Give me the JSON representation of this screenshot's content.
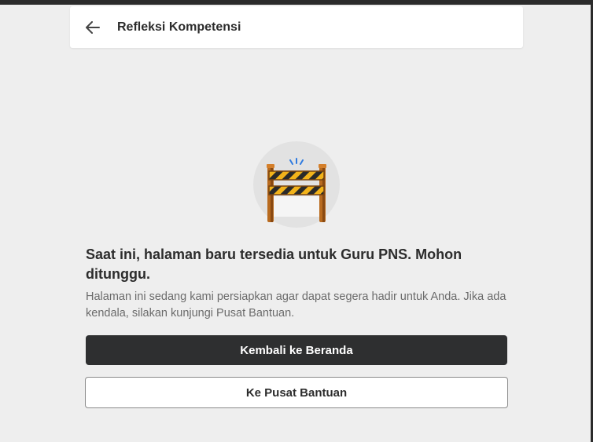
{
  "header": {
    "back_icon": "arrow-left-icon",
    "title": "Refleksi Kompetensi"
  },
  "illustration": {
    "icon": "road-barrier-icon"
  },
  "message": {
    "title": "Saat ini, halaman baru tersedia untuk Guru PNS. Mohon ditunggu.",
    "description": "Halaman ini sedang kami persiapkan agar dapat segera hadir untuk Anda. Jika ada kendala, silakan kunjungi Pusat Bantuan."
  },
  "actions": {
    "primary_label": "Kembali ke Beranda",
    "secondary_label": "Ke Pusat Bantuan"
  },
  "colors": {
    "background": "#eeeeee",
    "primary_button": "#2e2f30",
    "barrier_wood": "#b86a1e",
    "barrier_stripe_yellow": "#f2b31a",
    "light_accent": "#2f7be0"
  }
}
